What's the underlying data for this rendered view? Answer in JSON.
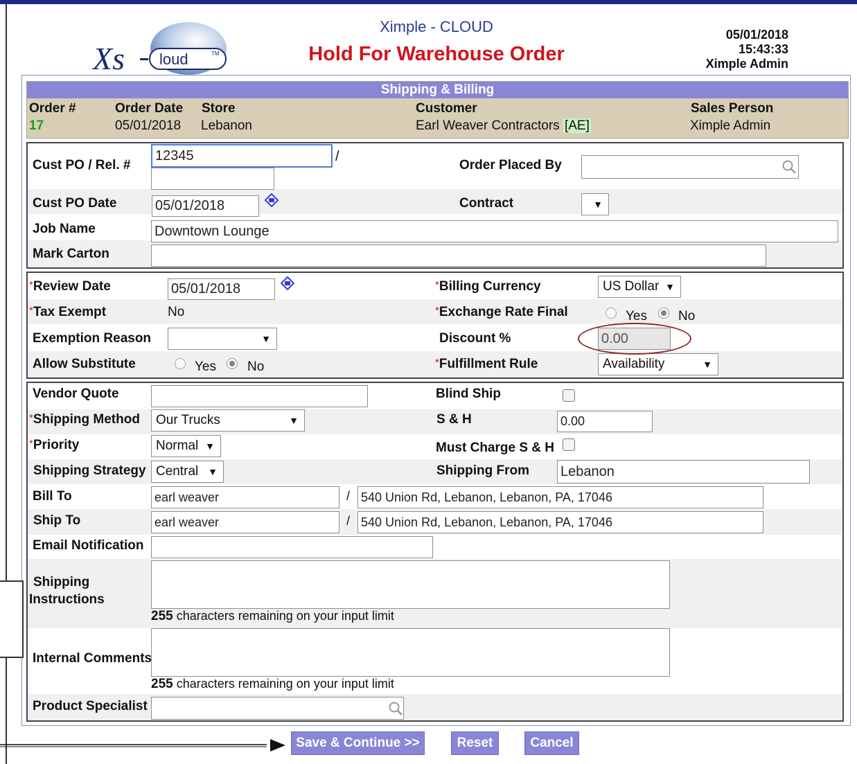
{
  "header": {
    "logo_text": "Xs Cloud",
    "app_title": "Ximple - CLOUD",
    "page_title": "Hold For Warehouse Order",
    "date": "05/01/2018",
    "time": "15:43:33",
    "user": "Ximple Admin"
  },
  "summary": {
    "title": "Shipping & Billing",
    "order_label": "Order #",
    "order_value": "17",
    "order_date_label": "Order Date",
    "order_date_value": "05/01/2018",
    "store_label": "Store",
    "store_value": "Lebanon",
    "customer_label": "Customer",
    "customer_value": "Earl Weaver Contractors",
    "customer_code": "[AE]",
    "sales_label": "Sales Person",
    "sales_value": "Ximple Admin"
  },
  "po": {
    "cust_po_label": "Cust PO / Rel. #",
    "cust_po_value": "12345",
    "rel_value": "",
    "slash": "/",
    "order_placed_by_label": "Order Placed By",
    "order_placed_by_value": "",
    "cust_po_date_label": "Cust PO Date",
    "cust_po_date_value": "05/01/2018",
    "contract_label": "Contract",
    "contract_value": "",
    "job_name_label": "Job Name",
    "job_name_value": "Downtown Lounge",
    "mark_carton_label": "Mark Carton",
    "mark_carton_value": ""
  },
  "billing": {
    "req_mark": "*",
    "review_date_label": "Review Date",
    "review_date_value": "05/01/2018",
    "billing_currency_label": "Billing Currency",
    "billing_currency_value": "US Dollar",
    "tax_exempt_label": "Tax Exempt",
    "tax_exempt_value": "No",
    "exchange_rate_label": "Exchange Rate Final",
    "yes_label": "Yes",
    "no_label": "No",
    "exemption_reason_label": "Exemption Reason",
    "exemption_reason_value": "",
    "discount_label": "Discount %",
    "discount_value": "0.00",
    "allow_substitute_label": "Allow Substitute",
    "fulfillment_rule_label": "Fulfillment Rule",
    "fulfillment_rule_value": "Availability"
  },
  "shipping": {
    "vendor_quote_label": "Vendor Quote",
    "vendor_quote_value": "",
    "blind_ship_label": "Blind Ship",
    "shipping_method_label": "Shipping Method",
    "shipping_method_value": "Our Trucks",
    "sh_label": "S & H",
    "sh_value": "0.00",
    "priority_label": "Priority",
    "priority_value": "Normal",
    "must_charge_label": "Must Charge S & H",
    "shipping_strategy_label": "Shipping Strategy",
    "shipping_strategy_value": "Central",
    "shipping_from_label": "Shipping From",
    "shipping_from_value": "Lebanon",
    "bill_to_label": "Bill To",
    "bill_to_name": "earl weaver",
    "bill_to_address": "540 Union Rd, Lebanon, Lebanon, PA, 17046",
    "ship_to_label": "Ship To",
    "ship_to_name": "earl weaver",
    "ship_to_address": "540 Union Rd, Lebanon, Lebanon, PA, 17046",
    "email_notification_label": "Email Notification",
    "email_notification_value": "",
    "shipping_instructions_label_1": "Shipping",
    "shipping_instructions_label_2": "Instructions",
    "shipping_instructions_value": "",
    "remaining_count": "255",
    "remaining_text": "characters remaining on your input limit",
    "internal_comments_label": "Internal Comments",
    "internal_comments_value": "",
    "remaining_count_2": "255",
    "remaining_text_2": "characters remaining on your input limit",
    "product_specialist_label": "Product Specialist",
    "product_specialist_value": ""
  },
  "buttons": {
    "save": "Save & Continue >>",
    "reset": "Reset",
    "cancel": "Cancel"
  },
  "colors": {
    "title_red": "#d0141d",
    "app_blue": "#2b3a99",
    "band_purple": "#8a86d6",
    "summary_tan": "#d8ceb6",
    "order_green": "#16a016"
  }
}
